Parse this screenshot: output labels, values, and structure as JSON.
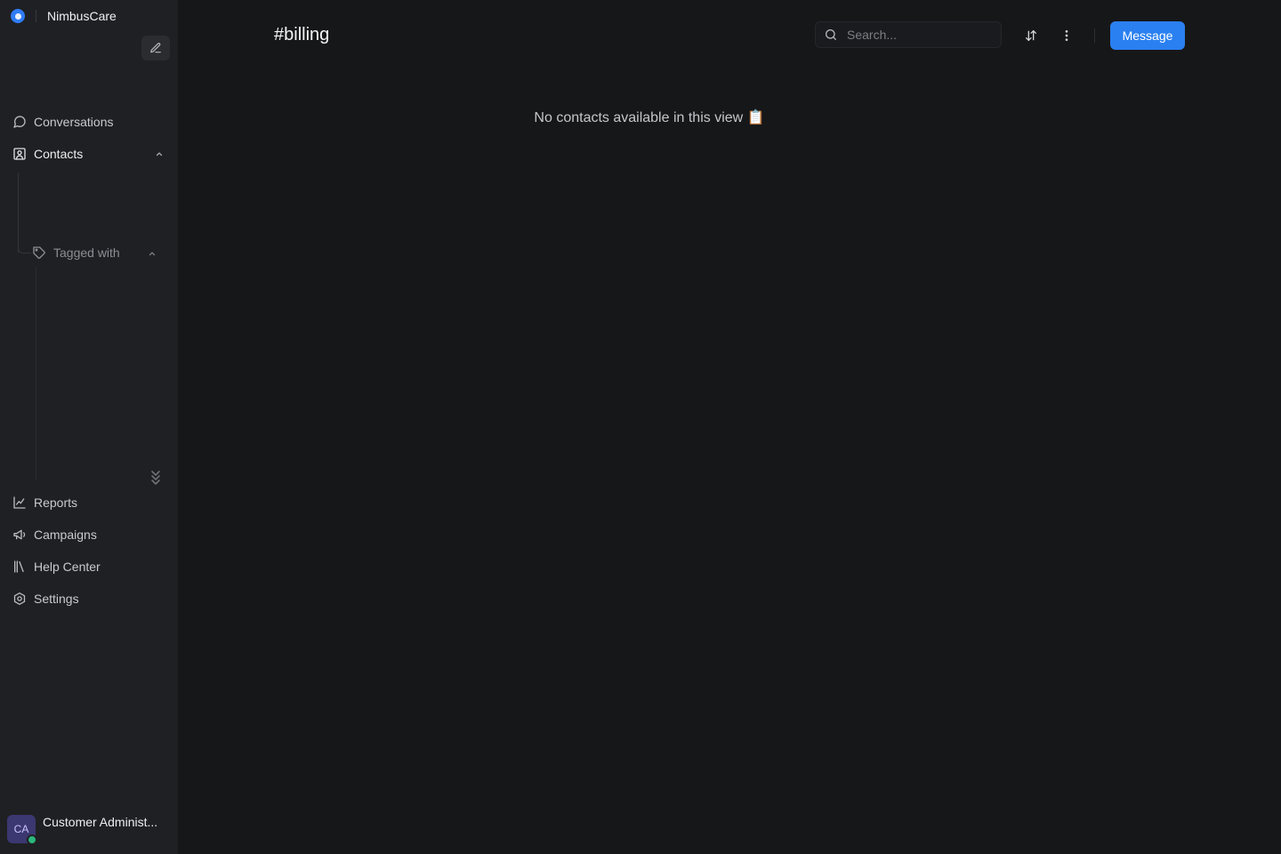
{
  "brand": {
    "name": "NimbusCare"
  },
  "sidebar": {
    "nav_top": [
      {
        "label": "Conversations",
        "icon": "chat-bubble-icon"
      },
      {
        "label": "Contacts",
        "icon": "contact-card-icon"
      }
    ],
    "tagged_with": {
      "label": "Tagged with",
      "icon": "tag-icon"
    },
    "nav_bottom": [
      {
        "label": "Reports",
        "icon": "line-chart-icon"
      },
      {
        "label": "Campaigns",
        "icon": "megaphone-icon"
      },
      {
        "label": "Help Center",
        "icon": "library-icon"
      },
      {
        "label": "Settings",
        "icon": "gear-icon"
      }
    ],
    "user": {
      "initials": "CA",
      "name": "Customer Administ...",
      "status": "online"
    }
  },
  "header": {
    "title": "#billing",
    "search_placeholder": "Search...",
    "message_button": "Message"
  },
  "main": {
    "empty_message": "No contacts available in this view 📋"
  },
  "colors": {
    "accent": "#2a80f0",
    "background": "#161719",
    "sidebar": "#1f2023",
    "presence": "#2cb67d"
  }
}
